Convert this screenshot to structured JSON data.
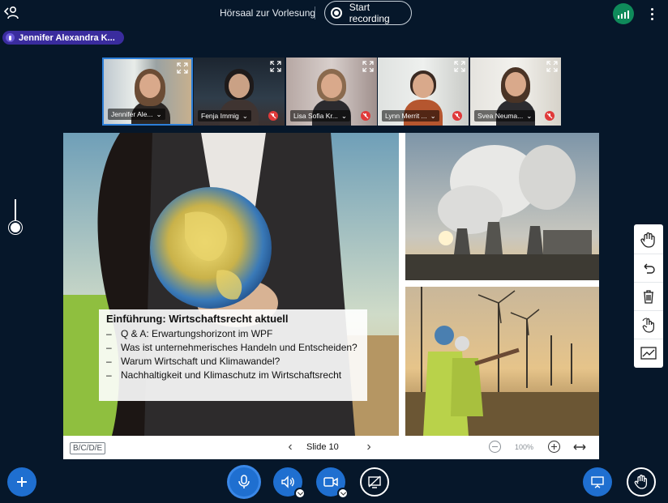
{
  "header": {
    "meeting_title": "Hörsaal zur Vorlesung",
    "record_label": "Start recording",
    "user_icon": "user-icon",
    "connection_icon": "signal-bars-icon",
    "more_icon": "more-vertical-icon"
  },
  "talking_indicator": {
    "name": "Jennifer Alexandra K..."
  },
  "participants": [
    {
      "name": "Jennifer Ale...",
      "muted": false,
      "active": true
    },
    {
      "name": "Fenja Immig",
      "muted": true,
      "active": false
    },
    {
      "name": "Lisa Sofia Kr...",
      "muted": true,
      "active": false
    },
    {
      "name": "Lynn Merrit ...",
      "muted": true,
      "active": false
    },
    {
      "name": "Svea Neuma...",
      "muted": true,
      "active": false
    }
  ],
  "slide": {
    "heading": "Einführung: Wirtschaftsrecht aktuell",
    "bullets": [
      "Q & A: Erwartungshorizont im WPF",
      "Was ist unternehmerisches Handeln und Entscheiden?",
      "Warum Wirtschaft und Klimawandel?",
      "Nachhaltigkeit und Klimaschutz im Wirtschaftsrecht"
    ]
  },
  "presentation_toolbar": {
    "layout_label": "B/C/D/E",
    "slide_label": "Slide 10",
    "zoom_level": "100%"
  },
  "colors": {
    "background": "#06172a",
    "primary": "#1f6fd0",
    "talking": "#3a2c9e",
    "connection": "#0f8a5a",
    "muted": "#e03a3a"
  }
}
